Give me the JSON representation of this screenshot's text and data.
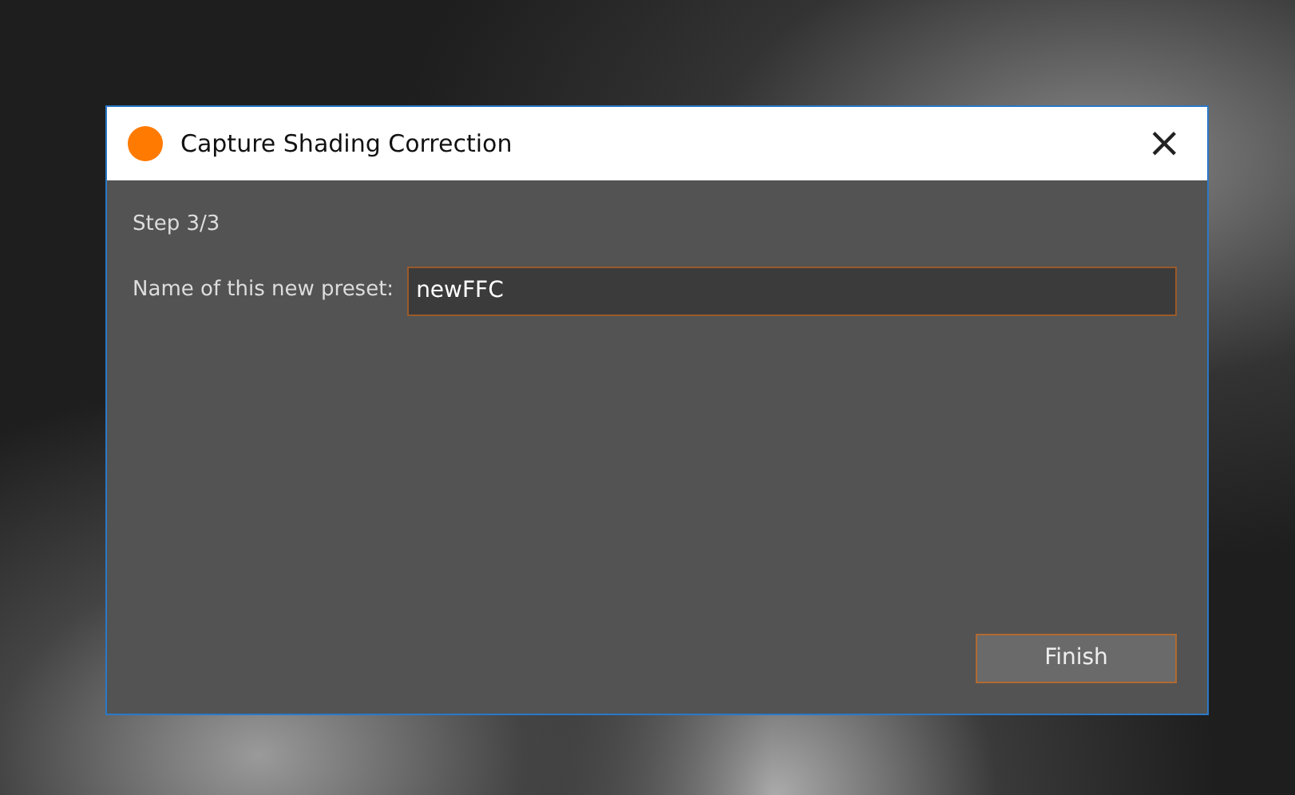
{
  "window": {
    "title": "Capture Shading Correction",
    "close": "×"
  },
  "step": "Step 3/3",
  "preset_field": {
    "label": "Name of this new preset:",
    "value": "newFFC"
  },
  "buttons": [
    "Finish"
  ]
}
